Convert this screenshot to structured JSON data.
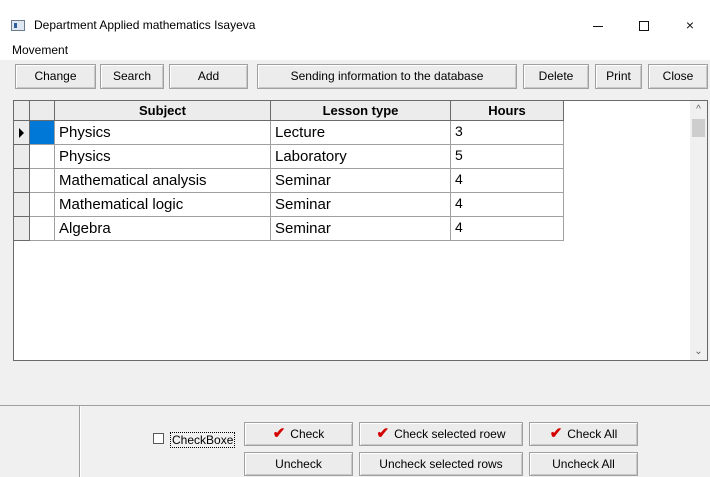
{
  "window": {
    "title": "Department Applied mathematics Isayeva",
    "icon": "app-window-icon",
    "controls": {
      "minimize": "minimize-icon",
      "maximize": "maximize-icon",
      "close": "×"
    }
  },
  "menu": {
    "items": [
      {
        "label": "Movement"
      }
    ]
  },
  "toolbar": {
    "buttons": [
      {
        "label": "Change"
      },
      {
        "label": "Search"
      },
      {
        "label": "Add"
      },
      {
        "label": "Sending information to the database"
      },
      {
        "label": "Delete"
      },
      {
        "label": "Print"
      },
      {
        "label": "Close"
      }
    ]
  },
  "grid": {
    "columns": [
      "Subject",
      "Lesson type",
      "Hours"
    ],
    "rows": [
      {
        "subject": "Physics",
        "lesson_type": "Lecture",
        "hours": "3",
        "current": true
      },
      {
        "subject": "Physics",
        "lesson_type": "Laboratory",
        "hours": "5",
        "current": false
      },
      {
        "subject": "Mathematical analysis",
        "lesson_type": "Seminar",
        "hours": "4",
        "current": false
      },
      {
        "subject": "Mathematical logic",
        "lesson_type": "Seminar",
        "hours": "4",
        "current": false
      },
      {
        "subject": "Algebra",
        "lesson_type": "Seminar",
        "hours": "4",
        "current": false
      }
    ],
    "selection_color": "#0078d7",
    "scroll_icons": {
      "up": "^",
      "down": "⌄"
    }
  },
  "bottom": {
    "checkbox_label": "CheckBoxe",
    "checkbox_checked": false,
    "check_mark": "✔",
    "check_mark_color": "#d40000",
    "buttons": {
      "check": "Check",
      "check_selected": "Check selected roew",
      "check_all": "Check All",
      "uncheck": "Uncheck",
      "uncheck_selected": "Uncheck selected rows",
      "uncheck_all": "Uncheck All"
    }
  }
}
